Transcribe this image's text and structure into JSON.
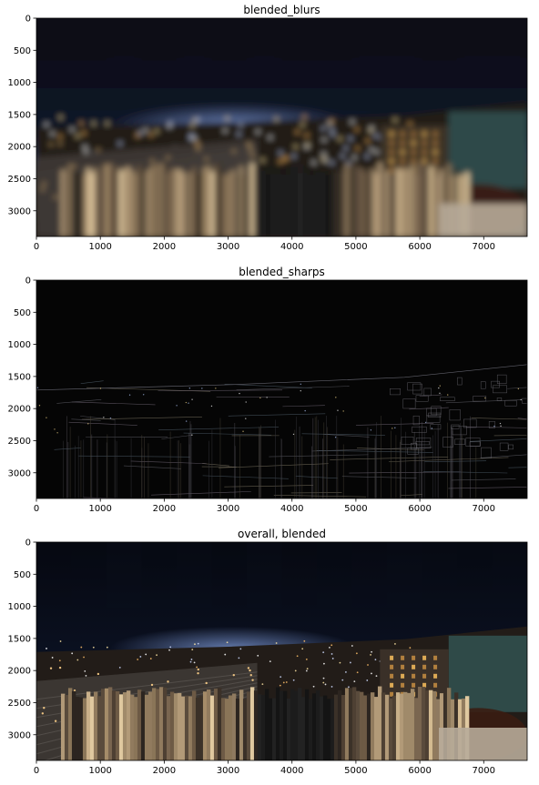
{
  "figure": {
    "background": "#ffffff"
  },
  "chart_data": [
    {
      "type": "image",
      "title": "blended_blurs",
      "xlabel": "",
      "ylabel": "",
      "xlim": [
        0,
        7680
      ],
      "ylim": [
        3400,
        0
      ],
      "xticks": [
        0,
        1000,
        2000,
        3000,
        4000,
        5000,
        6000,
        7000
      ],
      "yticks": [
        0,
        500,
        1000,
        1500,
        2000,
        2500,
        3000
      ],
      "style": "blurred night cityscape panorama"
    },
    {
      "type": "image",
      "title": "blended_sharps",
      "xlabel": "",
      "ylabel": "",
      "xlim": [
        0,
        7680
      ],
      "ylim": [
        3400,
        0
      ],
      "xticks": [
        0,
        1000,
        2000,
        3000,
        4000,
        5000,
        6000,
        7000
      ],
      "yticks": [
        0,
        500,
        1000,
        1500,
        2000,
        2500,
        3000
      ],
      "style": "edge map on black"
    },
    {
      "type": "image",
      "title": "overall, blended",
      "xlabel": "",
      "ylabel": "",
      "xlim": [
        0,
        7680
      ],
      "ylim": [
        3400,
        0
      ],
      "xticks": [
        0,
        1000,
        2000,
        3000,
        4000,
        5000,
        6000,
        7000
      ],
      "yticks": [
        0,
        500,
        1000,
        1500,
        2000,
        2500,
        3000
      ],
      "style": "night cityscape panorama"
    }
  ]
}
